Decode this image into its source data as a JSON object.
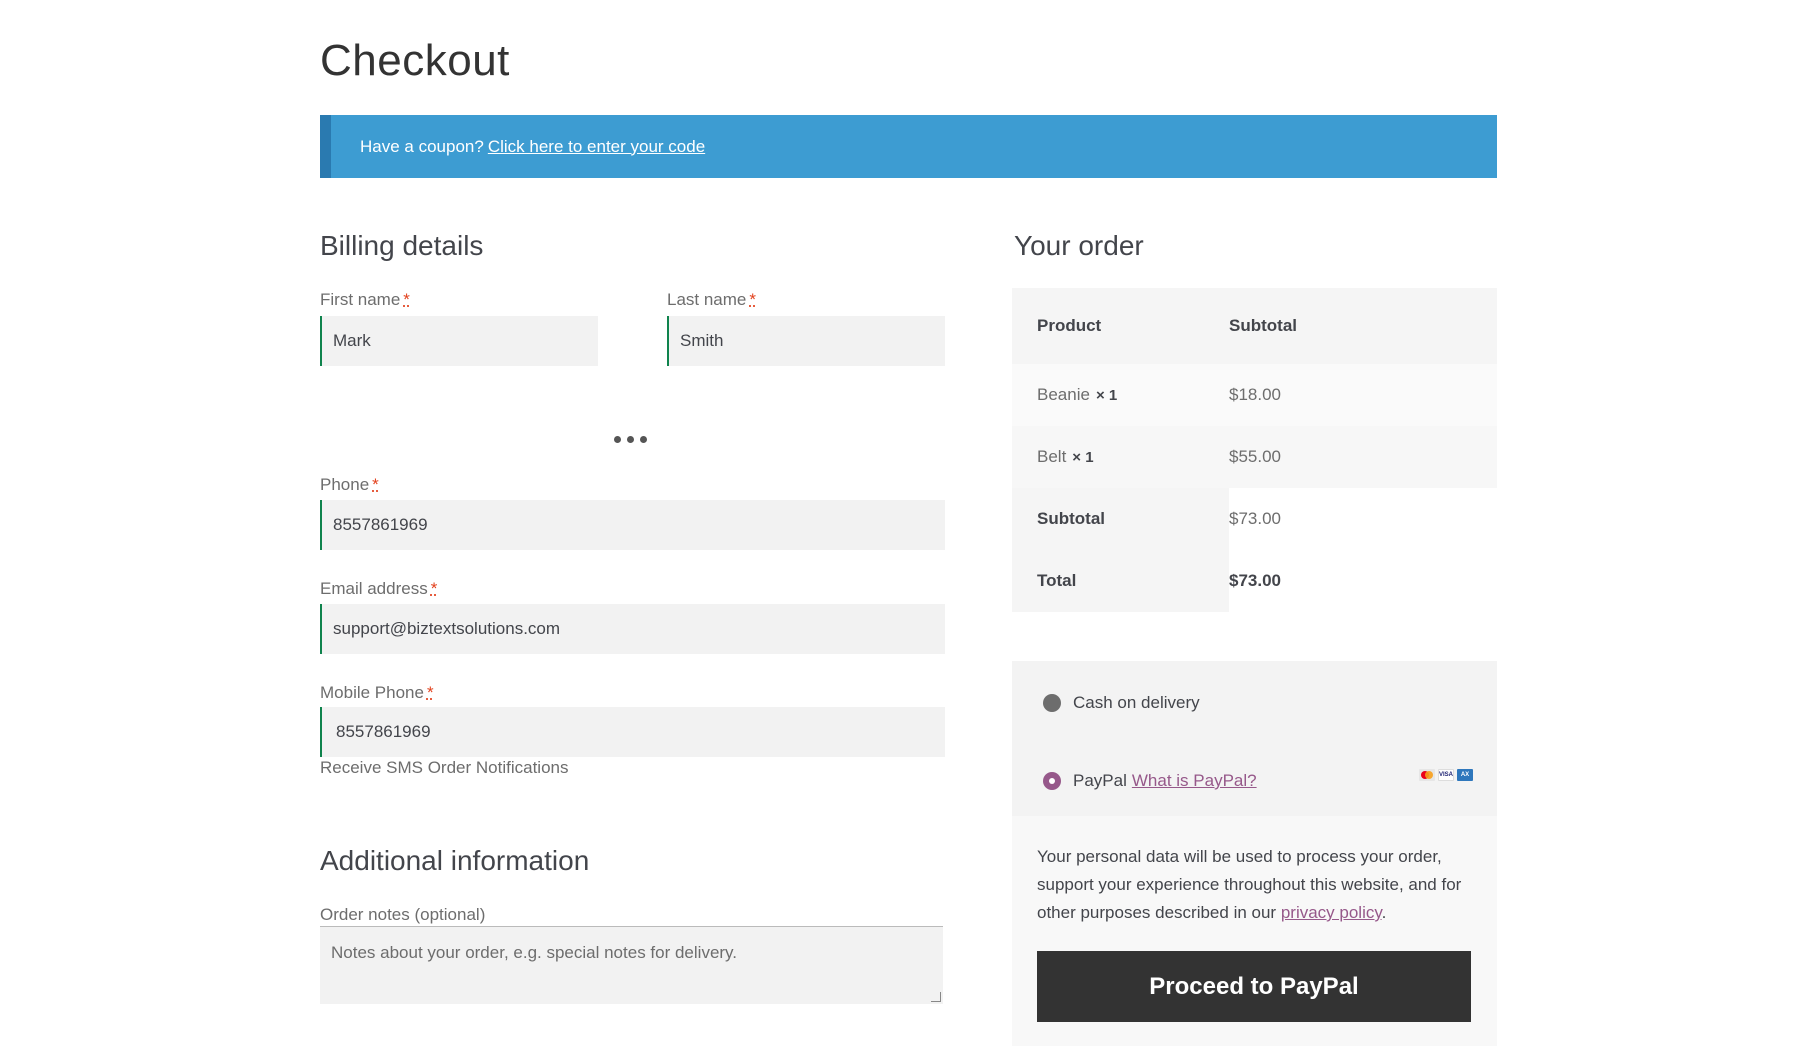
{
  "page": {
    "title": "Checkout"
  },
  "coupon": {
    "prefix": "Have a coupon?",
    "link": "Click here to enter your code"
  },
  "billing": {
    "title": "Billing details",
    "required_mark": "*",
    "first_name": {
      "label": "First name",
      "value": "Mark"
    },
    "last_name": {
      "label": "Last name",
      "value": "Smith"
    },
    "phone": {
      "label": "Phone",
      "value": "8557861969"
    },
    "email": {
      "label": "Email address",
      "value": "support@biztextsolutions.com"
    },
    "mobile": {
      "label": "Mobile Phone",
      "value": "8557861969",
      "helper": "Receive SMS Order Notifications"
    }
  },
  "additional": {
    "title": "Additional information",
    "notes_label": "Order notes (optional)",
    "notes_placeholder": "Notes about your order, e.g. special notes for delivery."
  },
  "order": {
    "title": "Your order",
    "headers": {
      "product": "Product",
      "subtotal": "Subtotal"
    },
    "items": [
      {
        "name": "Beanie",
        "qty": "× 1",
        "price": "$18.00"
      },
      {
        "name": "Belt",
        "qty": "× 1",
        "price": "$55.00"
      }
    ],
    "subtotal": {
      "label": "Subtotal",
      "value": "$73.00"
    },
    "total": {
      "label": "Total",
      "value": "$73.00"
    }
  },
  "payment": {
    "cod_label": "Cash on delivery",
    "paypal_label": "PayPal",
    "paypal_link": "What is PayPal?",
    "selected": "paypal",
    "privacy_text": "Your personal data will be used to process your order, support your experience throughout this website, and for other purposes described in our",
    "privacy_link": "privacy policy",
    "privacy_end": ".",
    "button": "Proceed to PayPal",
    "card_icons": [
      "mastercard-icon",
      "visa-icon",
      "amex-icon"
    ],
    "accent_color": "#96588a"
  },
  "colors": {
    "coupon_bg": "#3d9cd2",
    "input_accent": "#0f834d",
    "button_bg": "#333333"
  }
}
